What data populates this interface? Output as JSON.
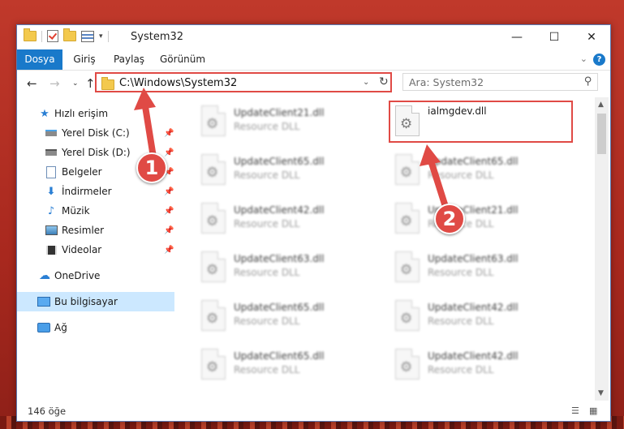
{
  "window": {
    "title": "System32",
    "controls": {
      "minimize": "—",
      "maximize": "☐",
      "close": "✕"
    }
  },
  "ribbon": {
    "tabs": [
      "Dosya",
      "Giriş",
      "Paylaş",
      "Görünüm"
    ],
    "help": "?"
  },
  "address": {
    "path": "C:\\Windows\\System32",
    "search_placeholder": "Ara: System32"
  },
  "sidebar": {
    "quick_access": "Hızlı erişim",
    "items": [
      {
        "label": "Yerel Disk (C:)",
        "icon": "drive-icon",
        "pinned": true
      },
      {
        "label": "Yerel Disk (D:)",
        "icon": "drive-icon",
        "pinned": true
      },
      {
        "label": "Belgeler",
        "icon": "documents-icon",
        "pinned": true
      },
      {
        "label": "İndirmeler",
        "icon": "download-icon",
        "pinned": true
      },
      {
        "label": "Müzik",
        "icon": "music-icon",
        "pinned": true
      },
      {
        "label": "Resimler",
        "icon": "pictures-icon",
        "pinned": true
      },
      {
        "label": "Videolar",
        "icon": "videos-icon",
        "pinned": true
      }
    ],
    "onedrive": "OneDrive",
    "this_pc": "Bu bilgisayar",
    "network": "Ağ"
  },
  "files": {
    "left_column": [
      {
        "name": "UpdateClient21.dll",
        "type": "Resource DLL"
      },
      {
        "name": "UpdateClient65.dll",
        "type": "Resource DLL"
      },
      {
        "name": "UpdateClient42.dll",
        "type": "Resource DLL"
      },
      {
        "name": "UpdateClient63.dll",
        "type": "Resource DLL"
      },
      {
        "name": "UpdateClient65.dll",
        "type": "Resource DLL"
      },
      {
        "name": "UpdateClient65.dll",
        "type": "Resource DLL"
      }
    ],
    "right_column": [
      {
        "name": "ialmgdev.dll",
        "type": ""
      },
      {
        "name": "UpdateClient65.dll",
        "type": "Resource DLL"
      },
      {
        "name": "UpdateClient21.dll",
        "type": "Resource DLL"
      },
      {
        "name": "UpdateClient63.dll",
        "type": "Resource DLL"
      },
      {
        "name": "UpdateClient42.dll",
        "type": "Resource DLL"
      },
      {
        "name": "UpdateClient42.dll",
        "type": "Resource DLL"
      }
    ]
  },
  "status": {
    "item_count": "146 öğe"
  },
  "annotations": {
    "step1": "1",
    "step2": "2",
    "color": "#e04a45"
  }
}
